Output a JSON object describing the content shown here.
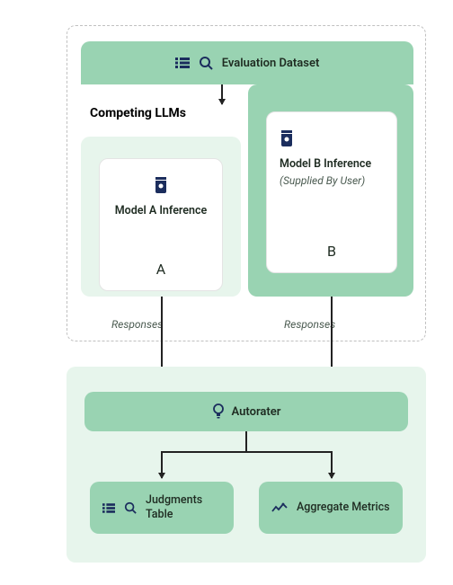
{
  "dataset": {
    "label": "Evaluation Dataset"
  },
  "competing_label": "Competing LLMs",
  "model_a": {
    "title": "Model A Inference",
    "sub": "",
    "letter": "A"
  },
  "model_b": {
    "title": "Model B Inference",
    "sub": "(Supplied By User)",
    "letter": "B"
  },
  "responses_label": "Responses",
  "autorater_label": "Autorater",
  "judgments_label": "Judgments Table",
  "aggregate_label": "Aggregate Metrics",
  "colors": {
    "accent": "#99d3b2",
    "pale": "#e7f5ec",
    "icon": "#1b2d5d"
  }
}
